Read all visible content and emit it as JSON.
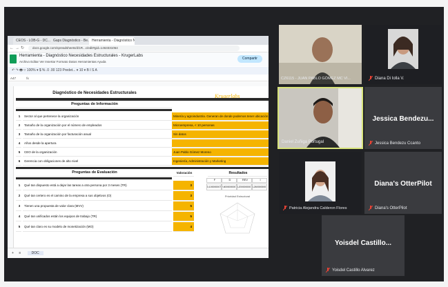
{
  "browser": {
    "tabs": [
      "CEOS - LOB-G - DC...",
      "Gaps Diagnóstico - Be...",
      "Herramienta - Diagnóstico N..."
    ],
    "url": "docs.google.com/spreadsheets/d/1R...c/edit#gid=1463331064"
  },
  "sheet": {
    "doc_title": "Herramienta - Diagnóstico Necesidades Estructurales - KrugerLabs",
    "menus": "Archivo  Editar  Ver  Insertar  Formato  Datos  Herramientas  Ayuda",
    "share_label": "Compartir",
    "toolbar": "↶  ↷  🖶  ⛉  100%  ▾   $  %  .0  .00  123   Predet...  ▾   10   ▾   B  I  S  A",
    "name_box": "A47",
    "formula": "fx",
    "section1_title": "Diagnóstico de Necesidades Estructurales",
    "section1_sub": "Preguntas de Información",
    "logo_text": "Krugerlabs",
    "info_rows": [
      {
        "n": "1",
        "q": "Sector al que pertenece la organización",
        "a": "Minería y agroindustria. Generan de donde podemos tener ubicación en."
      },
      {
        "n": "2",
        "q": "Tamaño de la organización por el número de empleados",
        "a": "Microempresa, < 10 personas"
      },
      {
        "n": "3",
        "q": "Tamaño de la organización por facturación anual",
        "a": "Sin datos"
      },
      {
        "n": "4",
        "q": "Años desde la apertura",
        "a": ""
      },
      {
        "n": "5",
        "q": "CEO de la organización",
        "a": "Juan Pablo Gómez Moreno"
      },
      {
        "n": "6",
        "q": "Gerencia con obligaciones de alto nivel",
        "a": "Ingeniería, Administración y Marketing"
      }
    ],
    "section2_title": "Preguntas de Evaluación",
    "valor_label": "Valoración",
    "resultados_label": "Resultados",
    "result_cols": [
      "F",
      "D",
      "REV",
      "I"
    ],
    "result_values": [
      "3,100000007",
      "2,6000000007",
      "4,2000000007",
      "4,2600000007"
    ],
    "eval_rows": [
      {
        "n": "1",
        "q": "Qué tan dispuesto está a dejar las tareas a otra persona por 3 meses (TR)",
        "v": "3"
      },
      {
        "n": "2",
        "q": "Qué tan certero es el camino de la empresa a sus objetivos (O)",
        "v": "3"
      },
      {
        "n": "3",
        "q": "Tienen una propuesta de valor clara (MVV)",
        "v": "5"
      },
      {
        "n": "4",
        "q": "Qué tan unificados están los equipos de trabajo (TR)",
        "v": "5"
      },
      {
        "n": "5",
        "q": "Qué tan claro es su modelo de monetización (MO)",
        "v": "4"
      }
    ],
    "chart_label": "Prioridad Estructural",
    "sheet_tab": "DOC"
  },
  "participants": [
    {
      "name": "CZ6115 - JUAN PABLO GÓMEZ MC VI..."
    },
    {
      "name": "Diana Di Iolla V."
    },
    {
      "name": "Daniel Zuñiga Portugal"
    },
    {
      "name": "Jessica Bendezu Ccanto",
      "display": "Jessica  Bendezu..."
    },
    {
      "name": "Patricia Alejandra Calderon Flores"
    },
    {
      "name": "Diana's OtterPilot",
      "display": "Diana's OtterPilot"
    },
    {
      "name": "Yoisdel Castillo Alvarez",
      "display": "Yoisdel  Castillo..."
    }
  ],
  "colors": {
    "accent": "#f5b400",
    "active_speaker": "#d7e37a",
    "tile": "#3c4043",
    "muted": "#ea4335"
  }
}
